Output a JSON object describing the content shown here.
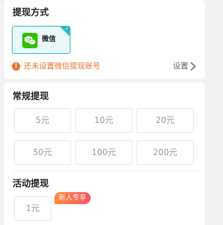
{
  "method_section": {
    "title": "提现方式",
    "method_label": "微信",
    "warning": "还未设置微信提现账号",
    "settings_label": "设置"
  },
  "regular_section": {
    "title": "常规提现",
    "amounts": [
      "5元",
      "10元",
      "20元",
      "50元",
      "100元",
      "200元"
    ]
  },
  "event_section": {
    "title": "活动提现",
    "amount": "1元",
    "badge": "新人专享"
  },
  "colors": {
    "accent_teal": "#2ab8c0",
    "warning_orange": "#e8742b",
    "wechat_green": "#2dc100",
    "badge_gradient": [
      "#ff8a3a",
      "#ff4f5e"
    ]
  },
  "icons": {
    "wechat": "wechat-icon",
    "warning": "warning-icon",
    "chevron": "chevron-right-icon",
    "selected": "check-corner-icon"
  }
}
